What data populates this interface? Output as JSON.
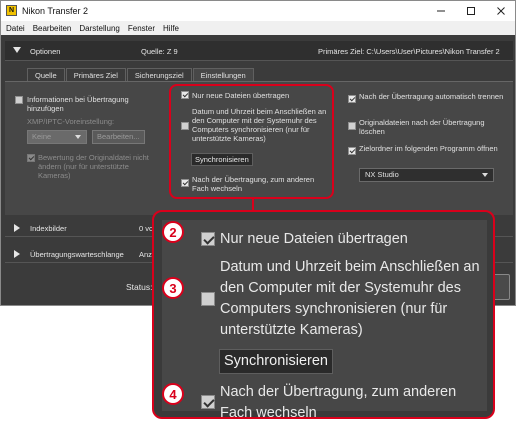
{
  "window": {
    "title": "Nikon Transfer 2",
    "app_icon_glyph": "N",
    "min_icon": "minimize-icon",
    "max_icon": "maximize-icon",
    "close_icon": "close-icon"
  },
  "menu": [
    "Datei",
    "Bearbeiten",
    "Darstellung",
    "Fenster",
    "Hilfe"
  ],
  "options": {
    "title": "Optionen",
    "source": "Quelle: Z 9",
    "destination": "Primäres Ziel: C:\\Users\\User\\Pictures\\Nikon Transfer 2"
  },
  "tabs": [
    {
      "label": "Quelle",
      "active": false
    },
    {
      "label": "Primäres Ziel",
      "active": false
    },
    {
      "label": "Sicherungsziel",
      "active": false
    },
    {
      "label": "Einstellungen",
      "active": true
    }
  ],
  "settings": {
    "left": {
      "info_label": "Informationen bei Übertragung hinzufügen",
      "info_checked": false,
      "xmp_label": "XMP/IPTC-Voreinstellung:",
      "xmp_value": "Keine",
      "edit_button": "Bearbeiten...",
      "rating_label": "Bewertung der Originaldatei nicht ändern (nur für unterstützte Kameras)",
      "rating_checked": true
    },
    "middle": {
      "new_files_label": "Nur neue Dateien übertragen",
      "new_files_checked": true,
      "sync_label": "Datum und Uhrzeit beim Anschließen an den Computer mit der Systemuhr des Computers synchronisieren (nur für unterstützte Kameras)",
      "sync_checked": false,
      "sync_button": "Synchronisieren",
      "switch_label": "Nach der Übertragung, zum anderen Fach wechseln",
      "switch_checked": true
    },
    "right": {
      "disconnect_label": "Nach der Übertragung automatisch trennen",
      "disconnect_checked": true,
      "delete_label": "Originaldateien nach der Übertragung löschen",
      "delete_checked": false,
      "open_label": "Zielordner im folgenden Programm öffnen",
      "open_checked": true,
      "program": "NX Studio"
    }
  },
  "rows": {
    "thumbnails_label": "Indexbilder",
    "thumbnails_extra": "0 vo",
    "queue_label": "Übertragungswarteschlange",
    "queue_extra": "Anz"
  },
  "status_label": "Status:",
  "callouts": {
    "badge_2": "2",
    "badge_3": "3",
    "badge_4": "4",
    "accent_color": "#d9001b"
  },
  "colors": {
    "panel_bg": "#474747",
    "window_bg": "#3b3b3b",
    "highlight": "#d9001b"
  }
}
